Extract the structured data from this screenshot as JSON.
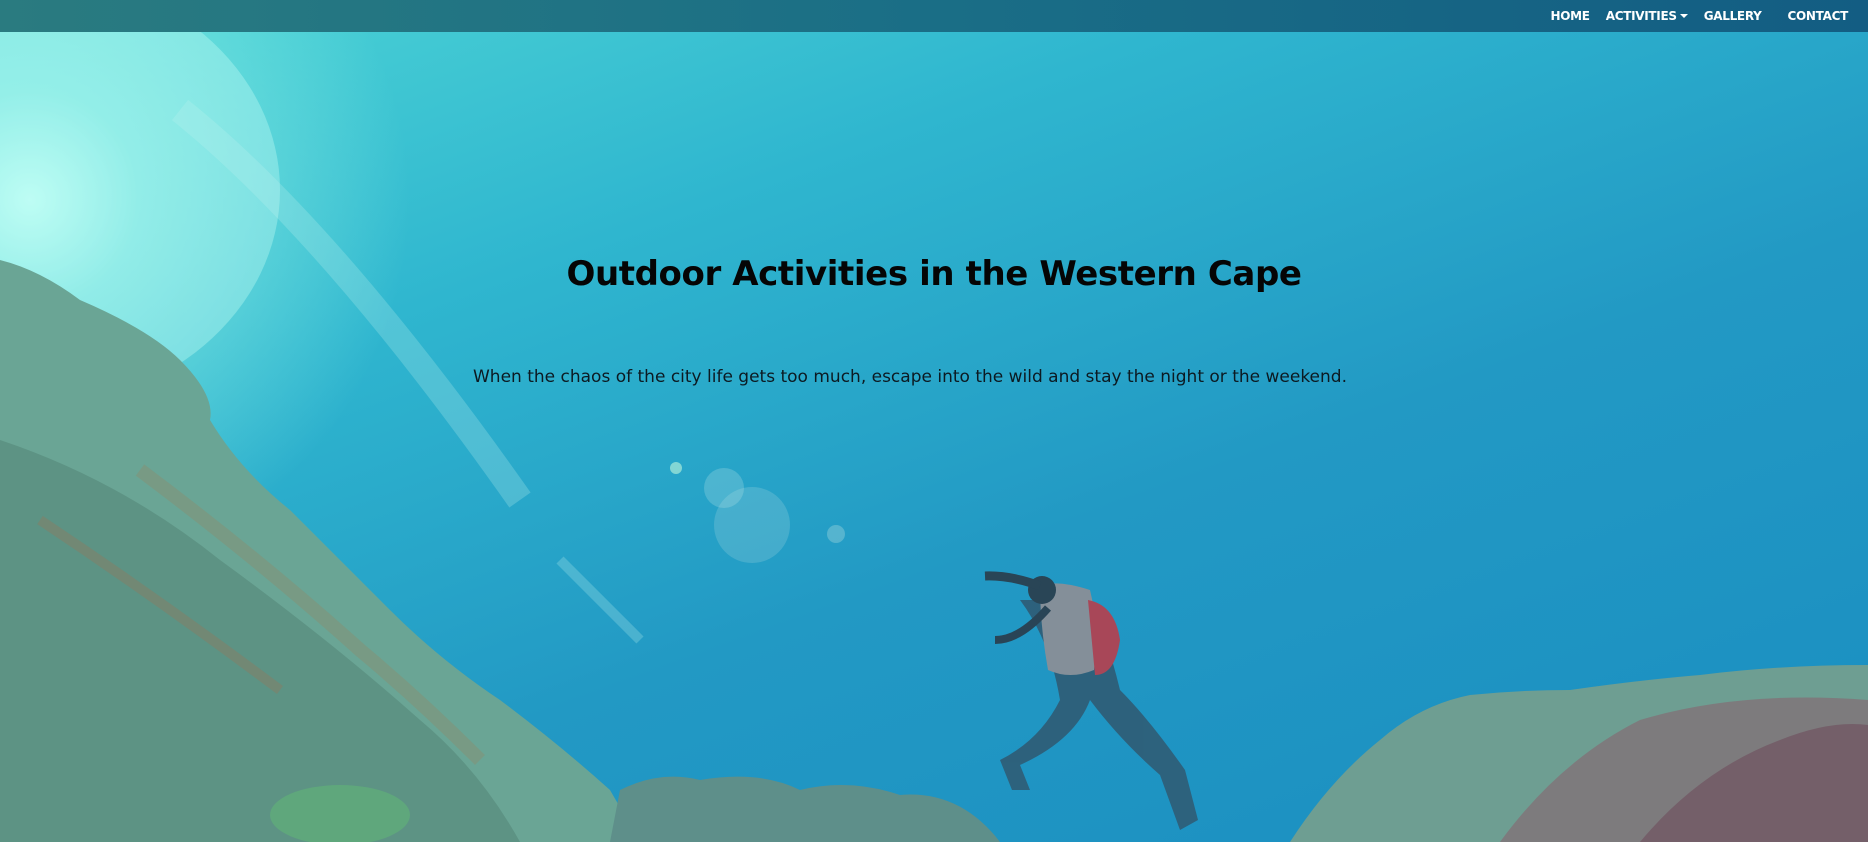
{
  "navbar": {
    "items": [
      {
        "label": "HOME"
      },
      {
        "label": "ACTIVITIES",
        "has_dropdown": true
      },
      {
        "label": "GALLERY"
      },
      {
        "label": "CONTACT"
      }
    ]
  },
  "hero": {
    "title": "Outdoor Activities in the Western Cape",
    "subtitle": "When the chaos of the city life gets too much, escape into the wild and stay the night or the weekend."
  },
  "colors": {
    "navbar": "#1a6e86",
    "overlay": "#2299c4",
    "title_text": "#050505"
  },
  "icons": {
    "dropdown": "chevron-down-icon"
  }
}
